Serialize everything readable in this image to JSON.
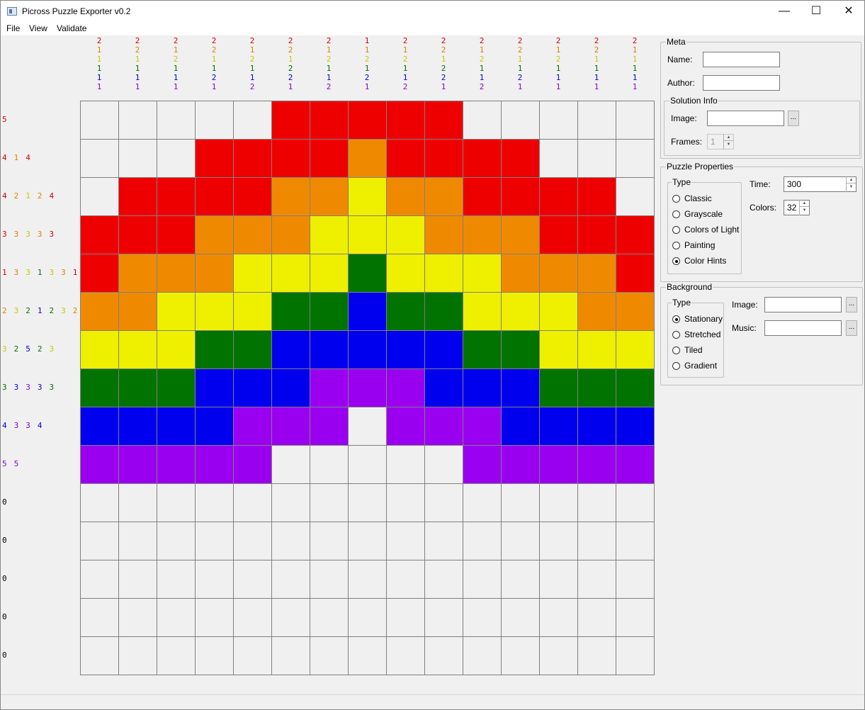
{
  "window": {
    "title": "Picross Puzzle Exporter v0.2",
    "minimize": "—",
    "maximize": "☐",
    "close": "✕"
  },
  "menu": {
    "file": "File",
    "view": "View",
    "validate": "Validate"
  },
  "palette": {
    "R": "#ef0000",
    "O": "#ef8a00",
    "Y": "#efef00",
    "G": "#007300",
    "B": "#0000ef",
    "P": "#9a00ef",
    ".": "#f0f0f0"
  },
  "clue_colors": {
    "r": "#d40000",
    "o": "#e08000",
    "y": "#c8c800",
    "g": "#007000",
    "b": "#0000d8",
    "p": "#8800d8",
    "k": "#000000"
  },
  "grid": [
    ".....RRRRR.....",
    "...RRRRORRRR...",
    ".RRRROOYOORRRR.",
    "RRROOOYYYOOORRR",
    "ROOOYYYGYYYOOOR",
    "OOYYYGGBGGYYYOO",
    "YYYGGBBBBBGGYYY",
    "GGGBBBPPPBBBGGG",
    "BBBBPPP.PPPBBBB",
    "PPPPP.....PPPPP",
    "...............",
    "...............",
    "...............",
    "...............",
    "..............."
  ],
  "col_clues": [
    [
      {
        "n": "2",
        "c": "r"
      },
      {
        "n": "1",
        "c": "o"
      },
      {
        "n": "1",
        "c": "y"
      },
      {
        "n": "1",
        "c": "g"
      },
      {
        "n": "1",
        "c": "b"
      },
      {
        "n": "1",
        "c": "p"
      }
    ],
    [
      {
        "n": "2",
        "c": "r"
      },
      {
        "n": "2",
        "c": "o"
      },
      {
        "n": "1",
        "c": "y"
      },
      {
        "n": "1",
        "c": "g"
      },
      {
        "n": "1",
        "c": "b"
      },
      {
        "n": "1",
        "c": "p"
      }
    ],
    [
      {
        "n": "2",
        "c": "r"
      },
      {
        "n": "1",
        "c": "o"
      },
      {
        "n": "2",
        "c": "y"
      },
      {
        "n": "1",
        "c": "g"
      },
      {
        "n": "1",
        "c": "b"
      },
      {
        "n": "1",
        "c": "p"
      }
    ],
    [
      {
        "n": "2",
        "c": "r"
      },
      {
        "n": "2",
        "c": "o"
      },
      {
        "n": "1",
        "c": "y"
      },
      {
        "n": "1",
        "c": "g"
      },
      {
        "n": "2",
        "c": "b"
      },
      {
        "n": "1",
        "c": "p"
      }
    ],
    [
      {
        "n": "2",
        "c": "r"
      },
      {
        "n": "1",
        "c": "o"
      },
      {
        "n": "2",
        "c": "y"
      },
      {
        "n": "1",
        "c": "g"
      },
      {
        "n": "1",
        "c": "b"
      },
      {
        "n": "2",
        "c": "p"
      }
    ],
    [
      {
        "n": "2",
        "c": "r"
      },
      {
        "n": "2",
        "c": "o"
      },
      {
        "n": "1",
        "c": "y"
      },
      {
        "n": "2",
        "c": "g"
      },
      {
        "n": "2",
        "c": "b"
      },
      {
        "n": "1",
        "c": "p"
      }
    ],
    [
      {
        "n": "2",
        "c": "r"
      },
      {
        "n": "1",
        "c": "o"
      },
      {
        "n": "2",
        "c": "y"
      },
      {
        "n": "1",
        "c": "g"
      },
      {
        "n": "1",
        "c": "b"
      },
      {
        "n": "2",
        "c": "p"
      }
    ],
    [
      {
        "n": "1",
        "c": "r"
      },
      {
        "n": "1",
        "c": "o"
      },
      {
        "n": "2",
        "c": "y"
      },
      {
        "n": "1",
        "c": "g"
      },
      {
        "n": "2",
        "c": "b"
      },
      {
        "n": "1",
        "c": "p"
      }
    ],
    [
      {
        "n": "2",
        "c": "r"
      },
      {
        "n": "1",
        "c": "o"
      },
      {
        "n": "2",
        "c": "y"
      },
      {
        "n": "1",
        "c": "g"
      },
      {
        "n": "1",
        "c": "b"
      },
      {
        "n": "2",
        "c": "p"
      }
    ],
    [
      {
        "n": "2",
        "c": "r"
      },
      {
        "n": "2",
        "c": "o"
      },
      {
        "n": "1",
        "c": "y"
      },
      {
        "n": "2",
        "c": "g"
      },
      {
        "n": "2",
        "c": "b"
      },
      {
        "n": "1",
        "c": "p"
      }
    ],
    [
      {
        "n": "2",
        "c": "r"
      },
      {
        "n": "1",
        "c": "o"
      },
      {
        "n": "2",
        "c": "y"
      },
      {
        "n": "1",
        "c": "g"
      },
      {
        "n": "1",
        "c": "b"
      },
      {
        "n": "2",
        "c": "p"
      }
    ],
    [
      {
        "n": "2",
        "c": "r"
      },
      {
        "n": "2",
        "c": "o"
      },
      {
        "n": "1",
        "c": "y"
      },
      {
        "n": "1",
        "c": "g"
      },
      {
        "n": "2",
        "c": "b"
      },
      {
        "n": "1",
        "c": "p"
      }
    ],
    [
      {
        "n": "2",
        "c": "r"
      },
      {
        "n": "1",
        "c": "o"
      },
      {
        "n": "2",
        "c": "y"
      },
      {
        "n": "1",
        "c": "g"
      },
      {
        "n": "1",
        "c": "b"
      },
      {
        "n": "1",
        "c": "p"
      }
    ],
    [
      {
        "n": "2",
        "c": "r"
      },
      {
        "n": "2",
        "c": "o"
      },
      {
        "n": "1",
        "c": "y"
      },
      {
        "n": "1",
        "c": "g"
      },
      {
        "n": "1",
        "c": "b"
      },
      {
        "n": "1",
        "c": "p"
      }
    ],
    [
      {
        "n": "2",
        "c": "r"
      },
      {
        "n": "1",
        "c": "o"
      },
      {
        "n": "1",
        "c": "y"
      },
      {
        "n": "1",
        "c": "g"
      },
      {
        "n": "1",
        "c": "b"
      },
      {
        "n": "1",
        "c": "p"
      }
    ]
  ],
  "row_clues": [
    [
      {
        "n": "5",
        "c": "r"
      }
    ],
    [
      {
        "n": "4",
        "c": "r"
      },
      {
        "n": "1",
        "c": "o"
      },
      {
        "n": "4",
        "c": "r"
      }
    ],
    [
      {
        "n": "4",
        "c": "r"
      },
      {
        "n": "2",
        "c": "o"
      },
      {
        "n": "1",
        "c": "y"
      },
      {
        "n": "2",
        "c": "o"
      },
      {
        "n": "4",
        "c": "r"
      }
    ],
    [
      {
        "n": "3",
        "c": "r"
      },
      {
        "n": "3",
        "c": "o"
      },
      {
        "n": "3",
        "c": "y"
      },
      {
        "n": "3",
        "c": "o"
      },
      {
        "n": "3",
        "c": "r"
      }
    ],
    [
      {
        "n": "1",
        "c": "r"
      },
      {
        "n": "3",
        "c": "o"
      },
      {
        "n": "3",
        "c": "y"
      },
      {
        "n": "1",
        "c": "g"
      },
      {
        "n": "3",
        "c": "y"
      },
      {
        "n": "3",
        "c": "o"
      },
      {
        "n": "1",
        "c": "r"
      }
    ],
    [
      {
        "n": "2",
        "c": "o"
      },
      {
        "n": "3",
        "c": "y"
      },
      {
        "n": "2",
        "c": "g"
      },
      {
        "n": "1",
        "c": "b"
      },
      {
        "n": "2",
        "c": "g"
      },
      {
        "n": "3",
        "c": "y"
      },
      {
        "n": "2",
        "c": "o"
      }
    ],
    [
      {
        "n": "3",
        "c": "y"
      },
      {
        "n": "2",
        "c": "g"
      },
      {
        "n": "5",
        "c": "b"
      },
      {
        "n": "2",
        "c": "g"
      },
      {
        "n": "3",
        "c": "y"
      }
    ],
    [
      {
        "n": "3",
        "c": "g"
      },
      {
        "n": "3",
        "c": "b"
      },
      {
        "n": "3",
        "c": "p"
      },
      {
        "n": "3",
        "c": "b"
      },
      {
        "n": "3",
        "c": "g"
      }
    ],
    [
      {
        "n": "4",
        "c": "b"
      },
      {
        "n": "3",
        "c": "p"
      },
      {
        "n": "3",
        "c": "p"
      },
      {
        "n": "4",
        "c": "b"
      }
    ],
    [
      {
        "n": "5",
        "c": "p"
      },
      {
        "n": "5",
        "c": "p"
      }
    ],
    [
      {
        "n": "0",
        "c": "k"
      }
    ],
    [
      {
        "n": "0",
        "c": "k"
      }
    ],
    [
      {
        "n": "0",
        "c": "k"
      }
    ],
    [
      {
        "n": "0",
        "c": "k"
      }
    ],
    [
      {
        "n": "0",
        "c": "k"
      }
    ]
  ],
  "meta": {
    "legend": "Meta",
    "name_label": "Name:",
    "name_value": "",
    "author_label": "Author:",
    "author_value": ""
  },
  "solution": {
    "legend": "Solution Info",
    "image_label": "Image:",
    "image_value": "",
    "browse": "...",
    "frames_label": "Frames:",
    "frames_value": "1"
  },
  "puzzle": {
    "legend": "Puzzle Properties",
    "type_legend": "Type",
    "types": [
      "Classic",
      "Grayscale",
      "Colors of Light",
      "Painting",
      "Color Hints"
    ],
    "selected_type": "Color Hints",
    "time_label": "Time:",
    "time_value": "300",
    "colors_label": "Colors:",
    "colors_value": "32"
  },
  "background": {
    "legend": "Background",
    "type_legend": "Type",
    "types": [
      "Stationary",
      "Stretched",
      "Tiled",
      "Gradient"
    ],
    "selected_type": "Stationary",
    "image_label": "Image:",
    "image_value": "",
    "music_label": "Music:",
    "music_value": "",
    "browse": "..."
  }
}
